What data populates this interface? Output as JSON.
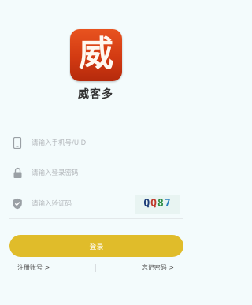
{
  "app": {
    "logo_char": "威",
    "name": "威客多"
  },
  "form": {
    "phone_placeholder": "请输入手机号/UID",
    "password_placeholder": "请输入登录密码",
    "captcha_placeholder": "请输入验证码",
    "captcha_chars": [
      "Q",
      "Q",
      "8",
      "7"
    ]
  },
  "actions": {
    "login_label": "登录",
    "register_label": "注册账号 >",
    "forgot_label": "忘记密码 >"
  },
  "colors": {
    "accent_button": "#e0bc2a",
    "logo_red": "#d23a12",
    "background": "#f3fbfc"
  }
}
